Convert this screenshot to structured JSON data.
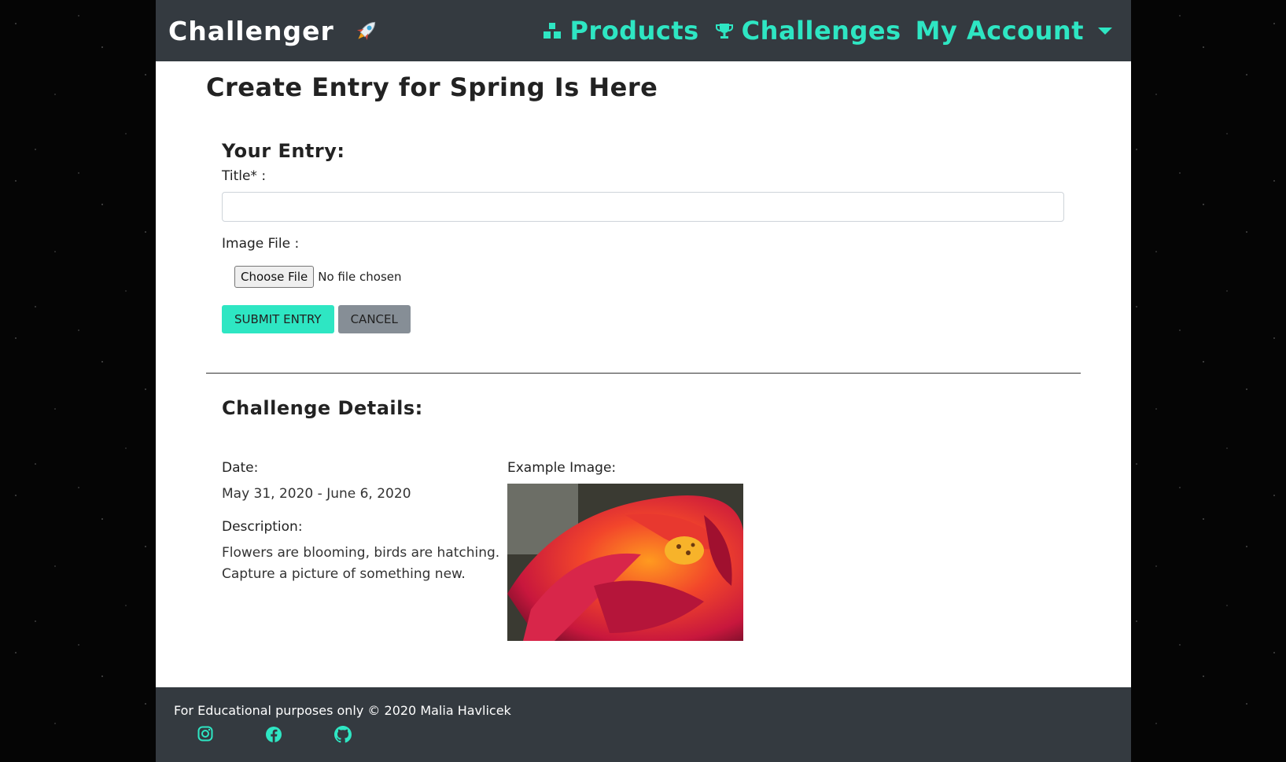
{
  "nav": {
    "brand": "Challenger",
    "products": "Products",
    "challenges": "Challenges",
    "account": "My Account"
  },
  "page_title": "Create Entry for Spring Is Here",
  "form": {
    "heading": "Your Entry:",
    "title_label": "Title* :",
    "title_value": "",
    "image_label": "Image File :",
    "file_button": "Choose File",
    "file_status": "No file chosen",
    "submit": "Submit Entry",
    "cancel": "Cancel"
  },
  "details": {
    "heading": "Challenge Details:",
    "date_label": "Date:",
    "date_value": "May 31, 2020 - June 6, 2020",
    "description_label": "Description:",
    "description_value": "Flowers are blooming, birds are hatching. Capture a picture of something new.",
    "example_label": "Example Image:"
  },
  "footer": {
    "text": "For Educational purposes only © 2020 Malia Havlicek"
  },
  "colors": {
    "accent": "#2ee6c3",
    "navbar": "#343a40",
    "secondary": "#868e96"
  }
}
